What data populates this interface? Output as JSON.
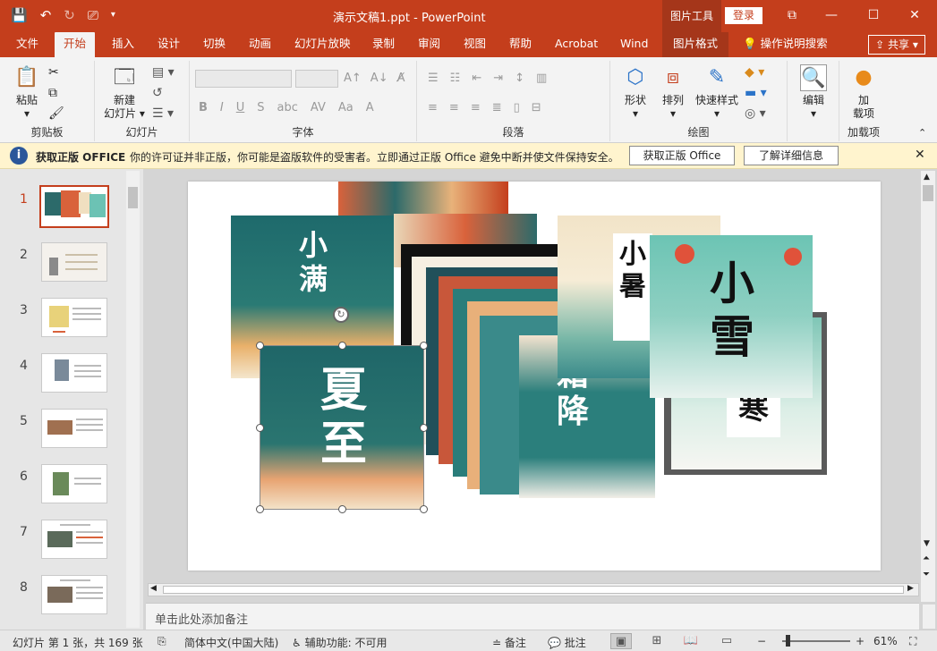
{
  "window": {
    "title": "演示文稿1.ppt  -  PowerPoint",
    "context_tab": "图片工具",
    "login": "登录",
    "colors": {
      "accent": "#c43e1c",
      "accent_dark": "#a5361a",
      "ribbon_bg": "#f3f3f3"
    }
  },
  "tabs": [
    {
      "label": "文件"
    },
    {
      "label": "开始"
    },
    {
      "label": "插入"
    },
    {
      "label": "设计"
    },
    {
      "label": "切换"
    },
    {
      "label": "动画"
    },
    {
      "label": "幻灯片放映"
    },
    {
      "label": "录制"
    },
    {
      "label": "审阅"
    },
    {
      "label": "视图"
    },
    {
      "label": "帮助"
    },
    {
      "label": "Acrobat"
    },
    {
      "label": "Wind"
    },
    {
      "label": "图片格式"
    },
    {
      "label": "操作说明搜索"
    }
  ],
  "share": "共享",
  "ribbon": {
    "paste": "粘贴",
    "new_slide_l1": "新建",
    "new_slide_l2": "幻灯片",
    "shape": "形状",
    "arrange": "排列",
    "quick_style": "快速样式",
    "edit": "编辑",
    "addin_l1": "加",
    "addin_l2": "载项",
    "groups": {
      "clipboard": "剪贴板",
      "slides": "幻灯片",
      "font": "字体",
      "paragraph": "段落",
      "drawing": "绘图",
      "addins": "加载项"
    }
  },
  "notice": {
    "title": "获取正版 OFFICE",
    "message": "你的许可证并非正版，你可能是盗版软件的受害者。立即通过正版 Office 避免中断并使文件保持安全。",
    "btn_get": "获取正版 Office",
    "btn_more": "了解详细信息"
  },
  "thumbnails": [
    {
      "num": "1"
    },
    {
      "num": "2"
    },
    {
      "num": "3"
    },
    {
      "num": "4"
    },
    {
      "num": "5"
    },
    {
      "num": "6"
    },
    {
      "num": "7"
    },
    {
      "num": "8"
    }
  ],
  "slide_text": {
    "xiaoman": "小满",
    "xiazhi": "夏至",
    "shuangjiang": "霜降",
    "xiaoshu": "小暑",
    "xiaoxue": "小雪",
    "han": "寒"
  },
  "notes_placeholder": "单击此处添加备注",
  "status": {
    "slide_info": "幻灯片 第 1 张，共 169 张",
    "language": "简体中文(中国大陆)",
    "accessibility": "辅助功能: 不可用",
    "notes": "备注",
    "comments": "批注",
    "zoom": "61%"
  }
}
